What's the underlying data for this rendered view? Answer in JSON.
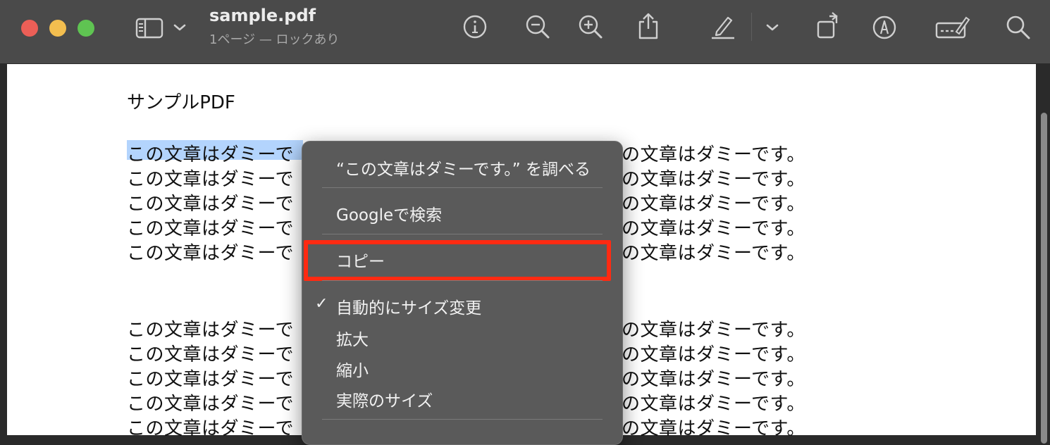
{
  "window": {
    "title": "sample.pdf",
    "subtitle": "1ページ — ロックあり"
  },
  "toolbar": {
    "icons": [
      "sidebar-toggle-icon",
      "chevron-down-icon",
      "info-icon",
      "zoom-out-icon",
      "zoom-in-icon",
      "share-icon",
      "highlight-pen-icon",
      "chevron-down-icon",
      "rotate-icon",
      "markup-icon",
      "form-fill-icon",
      "search-icon"
    ]
  },
  "document": {
    "heading": "サンプルPDF",
    "lines_group1": [
      "この文章はダミーで",
      "この文章はダミーで",
      "この文章はダミーで",
      "この文章はダミーで",
      "この文章はダミーで"
    ],
    "lines_group1_right": [
      "の文章はダミーです。",
      "の文章はダミーです。",
      "の文章はダミーです。",
      "の文章はダミーです。",
      "の文章はダミーです。"
    ],
    "lines_group2": [
      "この文章はダミーで",
      "この文章はダミーで",
      "この文章はダミーで",
      "この文章はダミーで",
      "この文章はダミーで"
    ],
    "lines_group2_right": [
      "の文章はダミーです。",
      "の文章はダミーです。",
      "の文章はダミーです。",
      "の文章はダミーです。",
      "の文章はダミーです。"
    ]
  },
  "context_menu": {
    "lookup": "“この文章はダミーです。” を調べる",
    "google": "Googleで検索",
    "copy": "コピー",
    "auto_resize": "自動的にサイズ変更",
    "zoom_in": "拡大",
    "zoom_out": "縮小",
    "actual_size": "実際のサイズ",
    "check_mark": "✓"
  },
  "colors": {
    "highlight_border": "#ff2a12",
    "selection": "#b3d4fd"
  }
}
